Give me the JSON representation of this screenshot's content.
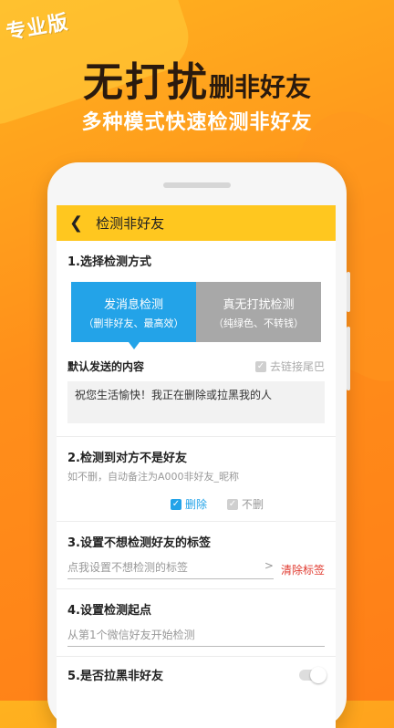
{
  "promo": {
    "badge": "专业版",
    "headline_big": "无打扰",
    "headline_small": "删非好友",
    "subheadline": "多种模式快速检测非好友"
  },
  "app": {
    "title": "检测非好友",
    "back_icon": "chevron-left-icon"
  },
  "section1": {
    "title": "1.选择检测方式",
    "modes": [
      {
        "title": "发消息检测",
        "subtitle": "（删非好友、最高效）",
        "selected": true
      },
      {
        "title": "真无打扰检测",
        "subtitle": "（纯绿色、不转钱）",
        "selected": false
      }
    ],
    "content_label": "默认发送的内容",
    "remove_link_label": "去链接尾巴",
    "message_text": "祝您生活愉快！我正在删除或拉黑我的人"
  },
  "section2": {
    "title": "2.检测到对方不是好友",
    "hint": "如不删，自动备注为A000非好友_昵称",
    "option_delete": "删除",
    "option_keep": "不删"
  },
  "section3": {
    "title": "3.设置不想检测好友的标签",
    "placeholder": "点我设置不想检测的标签",
    "arrow": ">",
    "clear_label": "清除标签"
  },
  "section4": {
    "title": "4.设置检测起点",
    "placeholder": "从第1个微信好友开始检测"
  },
  "section5": {
    "title": "5.是否拉黑非好友",
    "toggle_on": false
  },
  "colors": {
    "accent_blue": "#23a3e8",
    "appbar_yellow": "#ffc71f",
    "clear_red": "#e03a2f",
    "background_orange": "#ff8f1a"
  }
}
